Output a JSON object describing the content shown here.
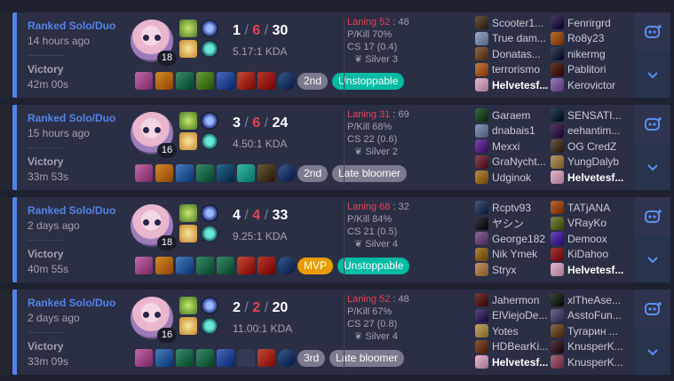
{
  "matches": [
    {
      "queue": "Ranked Solo/Duo",
      "ago": "14 hours ago",
      "result": "Victory",
      "duration": "42m 00s",
      "champion_icon": "champion-portrait",
      "level": "18",
      "kills": "1",
      "deaths": "6",
      "assists": "30",
      "kda_ratio": "5.17:1 KDA",
      "laning_label": "Laning 52",
      "laning_opp": " : 48",
      "pkill": "P/Kill 70%",
      "cs": "CS 17 (0.4)",
      "rank": "Silver 3",
      "badges": [
        {
          "text": "2nd",
          "color": "#7b7a8e"
        },
        {
          "text": "Unstoppable",
          "color": "#00bba3"
        }
      ],
      "team1": [
        {
          "name": "Scooter1...",
          "color": "#6b5a48"
        },
        {
          "name": "True dam...",
          "color": "#9aa9c8"
        },
        {
          "name": "Donatas...",
          "color": "#8d6a4f"
        },
        {
          "name": "terrorismo",
          "color": "#c47a43"
        },
        {
          "name": "Helvetesf...",
          "color": "#e8b8d0",
          "me": true
        }
      ],
      "team2": [
        {
          "name": "Fenrirgrd",
          "color": "#4b3a6a"
        },
        {
          "name": "Ro8y23",
          "color": "#b7702e"
        },
        {
          "name": "nikermg",
          "color": "#3c4a62"
        },
        {
          "name": "Pablitori",
          "color": "#6a3a2a"
        },
        {
          "name": "Kerovictor",
          "color": "#9a7ab8"
        }
      ]
    },
    {
      "queue": "Ranked Solo/Duo",
      "ago": "15 hours ago",
      "result": "Victory",
      "duration": "33m 53s",
      "champion_icon": "champion-portrait",
      "level": "16",
      "kills": "3",
      "deaths": "6",
      "assists": "24",
      "kda_ratio": "4.50:1 KDA",
      "laning_label": "Laning 31",
      "laning_opp": " : 69",
      "pkill": "P/Kill 68%",
      "cs": "CS 22 (0.6)",
      "rank": "Silver 2",
      "badges": [
        {
          "text": "2nd",
          "color": "#7b7a8e"
        },
        {
          "text": "Late bloomer",
          "color": "#7b7a8e"
        }
      ],
      "team1": [
        {
          "name": "Garaem",
          "color": "#3e6a4a"
        },
        {
          "name": "dnabais1",
          "color": "#8d9ab8"
        },
        {
          "name": "Mexxi",
          "color": "#7a4aa8"
        },
        {
          "name": "GraNycht...",
          "color": "#8a4a5a"
        },
        {
          "name": "Udginok",
          "color": "#b88a4a"
        }
      ],
      "team2": [
        {
          "name": "SENSATI...",
          "color": "#2a4a5a"
        },
        {
          "name": "eehantim...",
          "color": "#5a3a6a"
        },
        {
          "name": "OG CredZ",
          "color": "#6a5a4a"
        },
        {
          "name": "YungDalyb",
          "color": "#b89a6a"
        },
        {
          "name": "Helvetesf...",
          "color": "#e8b8d0",
          "me": true
        }
      ]
    },
    {
      "queue": "Ranked Solo/Duo",
      "ago": "2 days ago",
      "result": "Victory",
      "duration": "40m 55s",
      "champion_icon": "champion-portrait",
      "level": "18",
      "kills": "4",
      "deaths": "4",
      "assists": "33",
      "kda_ratio": "9.25:1 KDA",
      "laning_label": "Laning 68",
      "laning_opp": " : 32",
      "pkill": "P/Kill 84%",
      "cs": "CS 21 (0.5)",
      "rank": "Silver 4",
      "badges": [
        {
          "text": "MVP",
          "color": "#e89c00"
        },
        {
          "text": "Unstoppable",
          "color": "#00bba3"
        }
      ],
      "team1": [
        {
          "name": "Rcptv93",
          "color": "#4a5a7a"
        },
        {
          "name": "ヤシン",
          "color": "#3a3a4a"
        },
        {
          "name": "George182",
          "color": "#8a6a9a"
        },
        {
          "name": "Nik Ymek",
          "color": "#a8843a"
        },
        {
          "name": "Stryx",
          "color": "#c49a6a"
        }
      ],
      "team2": [
        {
          "name": "TATjANA",
          "color": "#b86a3a"
        },
        {
          "name": "VRayKo",
          "color": "#7a8a4a"
        },
        {
          "name": "Demoox",
          "color": "#6a4ab8"
        },
        {
          "name": "KiDahoo",
          "color": "#a83a3a"
        },
        {
          "name": "Helvetesf...",
          "color": "#e8b8d0",
          "me": true
        }
      ]
    },
    {
      "queue": "Ranked Solo/Duo",
      "ago": "2 days ago",
      "result": "Victory",
      "duration": "33m 09s",
      "champion_icon": "champion-portrait",
      "level": "16",
      "kills": "2",
      "deaths": "2",
      "assists": "20",
      "kda_ratio": "11.00:1 KDA",
      "laning_label": "Laning 52",
      "laning_opp": " : 48",
      "pkill": "P/Kill 67%",
      "cs": "CS 27 (0.8)",
      "rank": "Silver 4",
      "badges": [
        {
          "text": "3rd",
          "color": "#7b7a8e"
        },
        {
          "text": "Late bloomer",
          "color": "#7b7a8e"
        }
      ],
      "team1": [
        {
          "name": "Jahermon",
          "color": "#7a3a3a"
        },
        {
          "name": "ElViejoDe...",
          "color": "#5a4a7a"
        },
        {
          "name": "Yotes",
          "color": "#c4a86a"
        },
        {
          "name": "HDBearKi...",
          "color": "#8a5a3a"
        },
        {
          "name": "Helvetesf...",
          "color": "#e8b8d0",
          "me": true
        }
      ],
      "team2": [
        {
          "name": "xlTheAse...",
          "color": "#3a4a3a"
        },
        {
          "name": "AsstoFun...",
          "color": "#6a6a8a"
        },
        {
          "name": "Тугарин ...",
          "color": "#8a6a4a"
        },
        {
          "name": "KnusperK...",
          "color": "#5a3a4a"
        },
        {
          "name": "KnusperK...",
          "color": "#a86a7a"
        }
      ]
    }
  ],
  "colors": {
    "accent": "#5383e8",
    "death": "#e84057",
    "card": "#2b2f45"
  },
  "icons": {
    "spell1": "smite-spell-icon",
    "spell2": "flash-spell-icon",
    "rune1": "keystone-rune-icon",
    "rune2": "secondary-rune-icon",
    "rank": "rank-emblem-icon",
    "ai": "ai-analysis-icon",
    "expand": "chevron-down-icon"
  }
}
